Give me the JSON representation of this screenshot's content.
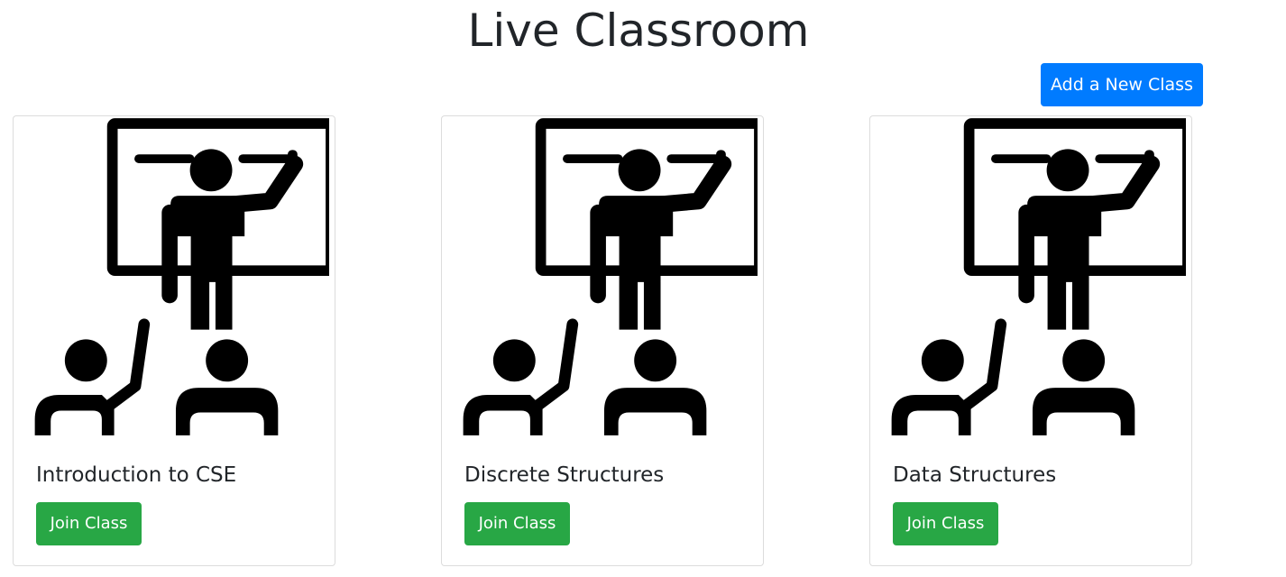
{
  "header": {
    "title": "Live Classroom",
    "add_button_label": "Add a New Class"
  },
  "classes": [
    {
      "title": "Introduction to CSE",
      "button_label": "Join Class",
      "image_icon": "teacher-classroom-icon"
    },
    {
      "title": "Discrete Structures",
      "button_label": "Join Class",
      "image_icon": "teacher-classroom-icon"
    },
    {
      "title": "Data Structures",
      "button_label": "Join Class",
      "image_icon": "teacher-classroom-icon"
    }
  ],
  "colors": {
    "primary": "#007bff",
    "success": "#28a745",
    "text": "#212529",
    "card_border": "#dcdcdc"
  }
}
